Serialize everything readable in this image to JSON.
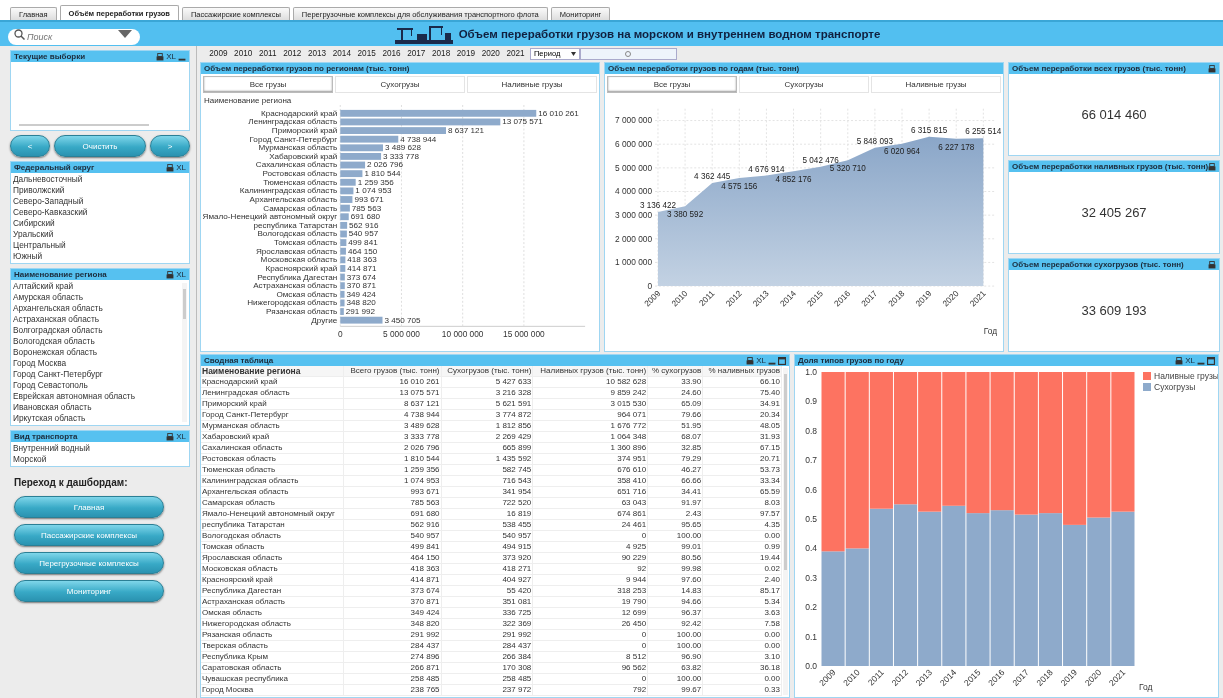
{
  "tabs": [
    {
      "label": "Главная",
      "selected": false
    },
    {
      "label": "Объём переработки грузов",
      "selected": true
    },
    {
      "label": "Пассажирские комплексы",
      "selected": false
    },
    {
      "label": "Перегрузочные комплексы для обслуживания транспортного флота",
      "selected": false
    },
    {
      "label": "Мониторинг",
      "selected": false
    }
  ],
  "search": {
    "placeholder": "Поиск"
  },
  "header": {
    "title": "Объем переработки грузов на морском и внутреннем водном транспорте"
  },
  "years": [
    "2009",
    "2010",
    "2011",
    "2012",
    "2013",
    "2014",
    "2015",
    "2016",
    "2017",
    "2018",
    "2019",
    "2020",
    "2021"
  ],
  "period": {
    "label": "Период"
  },
  "range_slider": {
    "level": 0.5
  },
  "current_selections": {
    "title": "Текущие выборки",
    "icons": [
      {
        "kind": "print"
      },
      {
        "kind": "text",
        "label": "XL"
      },
      {
        "kind": "minimize"
      }
    ]
  },
  "nav_buttons": [
    "<",
    "Очистить",
    ">"
  ],
  "federal_district": {
    "title": "Федеральный округ",
    "icons": [
      {
        "kind": "print"
      },
      {
        "kind": "text",
        "label": "XL"
      }
    ],
    "items": [
      "Дальневосточный",
      "Приволжский",
      "Северо-Западный",
      "Северо-Кавказский",
      "Сибирский",
      "Уральский",
      "Центральный",
      "Южный"
    ]
  },
  "region_list": {
    "title": "Наименование региона",
    "icons": [
      {
        "kind": "print"
      },
      {
        "kind": "text",
        "label": "XL"
      }
    ],
    "items": [
      "Алтайский край",
      "Амурская область",
      "Архангельская область",
      "Астраханская область",
      "Волгоградская область",
      "Вологодская область",
      "Воронежская область",
      "Город Москва",
      "Город Санкт-Петербург",
      "Город Севастополь",
      "Еврейская автономная область",
      "Ивановская область",
      "Иркутская область"
    ]
  },
  "transport": {
    "title": "Вид транспорта",
    "icons": [
      {
        "kind": "print"
      },
      {
        "kind": "text",
        "label": "XL"
      }
    ],
    "items": [
      "Внутренний водный",
      "Морской"
    ]
  },
  "dashboards": {
    "title": "Переход к дашбордам:",
    "buttons": [
      "Главная",
      "Пассажирские комплексы",
      "Перегрузочные комплексы",
      "Мониторинг"
    ]
  },
  "bar_panel": {
    "title": "Объем переработки грузов по регионам (тыс. тонн)",
    "tabs": [
      {
        "label": "Все грузы",
        "selected": true
      },
      {
        "label": "Сухогрузы",
        "selected": false
      },
      {
        "label": "Наливные грузы",
        "selected": false
      }
    ],
    "chart_data": {
      "type": "bar",
      "orientation": "horizontal",
      "ylabel": "Наименование региона",
      "data_labels": true,
      "grid": true,
      "xlim": [
        0,
        20000000
      ],
      "xticks": [
        {
          "value": 0,
          "label": "0"
        },
        {
          "value": 5000000,
          "label": "5 000 000"
        },
        {
          "value": 10000000,
          "label": "10 000 000"
        },
        {
          "value": 15000000,
          "label": "15 000 000"
        }
      ],
      "categories": [
        "Краснодарский край",
        "Ленинградская область",
        "Приморский край",
        "Город Санкт-Петербург",
        "Мурманская область",
        "Хабаровский край",
        "Сахалинская область",
        "Ростовская область",
        "Тюменская область",
        "Калининградская область",
        "Архангельская область",
        "Самарская область",
        "Ямало-Ненецкий автономный округ",
        "республика Татарстан",
        "Вологодская область",
        "Томская область",
        "Ярославская область",
        "Московская область",
        "Красноярский край",
        "Республика Дагестан",
        "Астраханская область",
        "Омская область",
        "Нижегородская область",
        "Рязанская область",
        "Другие"
      ],
      "values": [
        16010261,
        13075571,
        8637121,
        4738944,
        3489628,
        3333778,
        2026796,
        1810544,
        1259356,
        1074953,
        993671,
        785563,
        691680,
        562916,
        540957,
        499841,
        464150,
        418363,
        414871,
        373674,
        370871,
        349424,
        348820,
        291992,
        3450705
      ]
    }
  },
  "line_panel": {
    "title": "Объем переработки грузов по годам (тыс. тонн)",
    "tabs": [
      {
        "label": "Все грузы",
        "selected": true
      },
      {
        "label": "Сухогрузы",
        "selected": false
      },
      {
        "label": "Наливные грузы",
        "selected": false
      }
    ],
    "chart_data": {
      "type": "area",
      "xlabel": "Год",
      "data_labels": true,
      "grid": true,
      "ylim": [
        0,
        7500000
      ],
      "yticks": [
        {
          "value": 0,
          "label": "0"
        },
        {
          "value": 1000000,
          "label": "1 000 000"
        },
        {
          "value": 2000000,
          "label": "2 000 000"
        },
        {
          "value": 3000000,
          "label": "3 000 000"
        },
        {
          "value": 4000000,
          "label": "4 000 000"
        },
        {
          "value": 5000000,
          "label": "5 000 000"
        },
        {
          "value": 6000000,
          "label": "6 000 000"
        },
        {
          "value": 7000000,
          "label": "7 000 000"
        }
      ],
      "x": [
        "2009",
        "2010",
        "2011",
        "2012",
        "2013",
        "2014",
        "2015",
        "2016",
        "2017",
        "2018",
        "2019",
        "2020",
        "2021"
      ],
      "values": [
        3136422,
        3380592,
        4362445,
        4575156,
        4676914,
        4852176,
        5042476,
        5320710,
        5848093,
        6020964,
        6315815,
        6227178,
        6255514
      ]
    }
  },
  "kpis": [
    {
      "title": "Объем переработки всех грузов (тыс. тонн)",
      "value": "66 014 460"
    },
    {
      "title": "Объем переработки наливных грузов (тыс. тонн)",
      "value": "32 405 267"
    },
    {
      "title": "Объем переработки сухогрузов (тыс. тонн)",
      "value": "33 609 193"
    }
  ],
  "table": {
    "title": "Сводная таблица",
    "icons": [
      {
        "kind": "print"
      },
      {
        "kind": "text",
        "label": "XL"
      },
      {
        "kind": "minimize"
      },
      {
        "kind": "maximize"
      }
    ],
    "columns": [
      "Наименование региона",
      "Всего грузов (тыс. тонн)",
      "Сухогрузов (тыс. тонн)",
      "Наливных грузов (тыс. тонн)",
      "% сухогрузов",
      "% наливных грузов"
    ],
    "rows": [
      [
        "Краснодарский край",
        "16 010 261",
        "5 427 633",
        "10 582 628",
        "33.90",
        "66.10"
      ],
      [
        "Ленинградская область",
        "13 075 571",
        "3 216 328",
        "9 859 242",
        "24.60",
        "75.40"
      ],
      [
        "Приморский край",
        "8 637 121",
        "5 621 591",
        "3 015 530",
        "65.09",
        "34.91"
      ],
      [
        "Город Санкт-Петербург",
        "4 738 944",
        "3 774 872",
        "964 071",
        "79.66",
        "20.34"
      ],
      [
        "Мурманская область",
        "3 489 628",
        "1 812 856",
        "1 676 772",
        "51.95",
        "48.05"
      ],
      [
        "Хабаровский край",
        "3 333 778",
        "2 269 429",
        "1 064 348",
        "68.07",
        "31.93"
      ],
      [
        "Сахалинская область",
        "2 026 796",
        "665 899",
        "1 360 896",
        "32.85",
        "67.15"
      ],
      [
        "Ростовская область",
        "1 810 544",
        "1 435 592",
        "374 951",
        "79.29",
        "20.71"
      ],
      [
        "Тюменская область",
        "1 259 356",
        "582 745",
        "676 610",
        "46.27",
        "53.73"
      ],
      [
        "Калининградская область",
        "1 074 953",
        "716 543",
        "358 410",
        "66.66",
        "33.34"
      ],
      [
        "Архангельская область",
        "993 671",
        "341 954",
        "651 716",
        "34.41",
        "65.59"
      ],
      [
        "Самарская область",
        "785 563",
        "722 520",
        "63 043",
        "91.97",
        "8.03"
      ],
      [
        "Ямало-Ненецкий автономный округ",
        "691 680",
        "16 819",
        "674 861",
        "2.43",
        "97.57"
      ],
      [
        "республика Татарстан",
        "562 916",
        "538 455",
        "24 461",
        "95.65",
        "4.35"
      ],
      [
        "Вологодская область",
        "540 957",
        "540 957",
        "0",
        "100.00",
        "0.00"
      ],
      [
        "Томская область",
        "499 841",
        "494 915",
        "4 925",
        "99.01",
        "0.99"
      ],
      [
        "Ярославская область",
        "464 150",
        "373 920",
        "90 229",
        "80.56",
        "19.44"
      ],
      [
        "Московская область",
        "418 363",
        "418 271",
        "92",
        "99.98",
        "0.02"
      ],
      [
        "Красноярский край",
        "414 871",
        "404 927",
        "9 944",
        "97.60",
        "2.40"
      ],
      [
        "Республика Дагестан",
        "373 674",
        "55 420",
        "318 253",
        "14.83",
        "85.17"
      ],
      [
        "Астраханская область",
        "370 871",
        "351 081",
        "19 790",
        "94.66",
        "5.34"
      ],
      [
        "Омская область",
        "349 424",
        "336 725",
        "12 699",
        "96.37",
        "3.63"
      ],
      [
        "Нижегородская область",
        "348 820",
        "322 369",
        "26 450",
        "92.42",
        "7.58"
      ],
      [
        "Рязанская область",
        "291 992",
        "291 992",
        "0",
        "100.00",
        "0.00"
      ],
      [
        "Тверская область",
        "284 437",
        "284 437",
        "0",
        "100.00",
        "0.00"
      ],
      [
        "Республика Крым",
        "274 896",
        "266 384",
        "8 512",
        "96.90",
        "3.10"
      ],
      [
        "Саратовская область",
        "266 871",
        "170 308",
        "96 562",
        "63.82",
        "36.18"
      ],
      [
        "Чувашская республика",
        "258 485",
        "258 485",
        "0",
        "100.00",
        "0.00"
      ],
      [
        "Город Москва",
        "238 765",
        "237 972",
        "792",
        "99.67",
        "0.33"
      ]
    ]
  },
  "share_panel": {
    "title": "Доля типов грузов по году",
    "icons": [
      {
        "kind": "print"
      },
      {
        "kind": "text",
        "label": "XL"
      },
      {
        "kind": "minimize"
      },
      {
        "kind": "maximize"
      }
    ],
    "chart_data": {
      "type": "bar",
      "stacked": true,
      "legend": "right",
      "xlabel": "Год",
      "ylim": [
        0,
        1
      ],
      "yticks": [
        {
          "value": 0,
          "label": "0.0"
        },
        {
          "value": 0.1,
          "label": "0.1"
        },
        {
          "value": 0.2,
          "label": "0.2"
        },
        {
          "value": 0.3,
          "label": "0.3"
        },
        {
          "value": 0.4,
          "label": "0.4"
        },
        {
          "value": 0.5,
          "label": "0.5"
        },
        {
          "value": 0.6,
          "label": "0.6"
        },
        {
          "value": 0.7,
          "label": "0.7"
        },
        {
          "value": 0.8,
          "label": "0.8"
        },
        {
          "value": 0.9,
          "label": "0.9"
        },
        {
          "value": 1,
          "label": "1.0"
        }
      ],
      "categories": [
        "2009",
        "2010",
        "2011",
        "2012",
        "2013",
        "2014",
        "2015",
        "2016",
        "2017",
        "2018",
        "2019",
        "2020",
        "2021"
      ],
      "series": [
        {
          "name": "Сухогрузы",
          "color": "#8eaacb",
          "values": [
            0.39,
            0.4,
            0.535,
            0.55,
            0.525,
            0.545,
            0.52,
            0.53,
            0.515,
            0.52,
            0.48,
            0.505,
            0.525
          ]
        },
        {
          "name": "Наливные грузы",
          "color": "#fd7361",
          "values": [
            0.61,
            0.6,
            0.465,
            0.45,
            0.475,
            0.455,
            0.48,
            0.47,
            0.485,
            0.48,
            0.52,
            0.495,
            0.475
          ]
        }
      ]
    }
  }
}
